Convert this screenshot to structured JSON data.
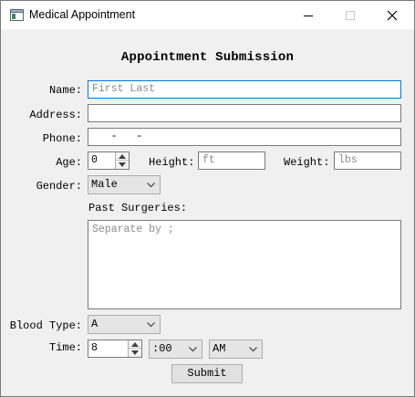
{
  "window": {
    "title": "Medical Appointment",
    "icons": {
      "app": "window-app-icon",
      "minimize": "minimize-icon",
      "maximize": "maximize-icon",
      "close": "close-icon"
    }
  },
  "form": {
    "heading": "Appointment Submission",
    "name": {
      "label": "Name:",
      "value": "",
      "placeholder": "First Last"
    },
    "address": {
      "label": "Address:",
      "value": ""
    },
    "phone": {
      "label": "Phone:",
      "mask": "   -   -"
    },
    "age": {
      "label": "Age:",
      "value": "0"
    },
    "height": {
      "label": "Height:",
      "placeholder": "ft"
    },
    "weight": {
      "label": "Weight:",
      "placeholder": "lbs"
    },
    "gender": {
      "label": "Gender:",
      "selected": "Male"
    },
    "surgeries": {
      "label": "Past Surgeries:",
      "placeholder": "Separate by ;"
    },
    "blood_type": {
      "label": "Blood Type:",
      "selected": "A"
    },
    "time": {
      "label": "Time:",
      "hour": "8",
      "minute": ":00",
      "period": "AM"
    },
    "submit_label": "Submit"
  }
}
